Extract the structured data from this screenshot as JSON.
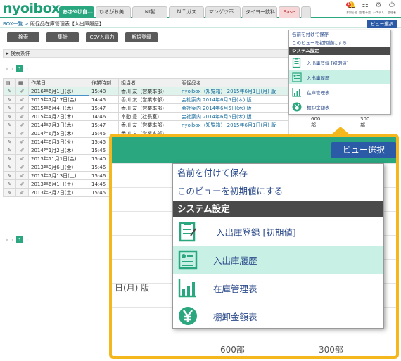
{
  "app": {
    "logo": "nyoibox"
  },
  "tabs": [
    {
      "label": "あさやけ自...",
      "active": true
    },
    {
      "label": "ひるがお美..."
    },
    {
      "label": "NI製"
    },
    {
      "label": "ＮＩガス"
    },
    {
      "label": "マンゲツ不..."
    },
    {
      "label": "タイヨー飲料"
    },
    {
      "label": "Base",
      "base": true
    },
    {
      "label": "⋮"
    }
  ],
  "top_icons": [
    {
      "icon": "notification-icon",
      "glyph": "🔔",
      "label": "お知らせ",
      "badge": "1"
    },
    {
      "icon": "org-chart-icon",
      "glyph": "⚏",
      "label": "部署不要"
    },
    {
      "icon": "gear-icon",
      "glyph": "⚙",
      "label": "システム"
    },
    {
      "icon": "power-icon",
      "glyph": "⏻",
      "label": "管理者"
    }
  ],
  "breadcrumb": {
    "root": "BOX一覧",
    "sep": " > ",
    "current": "販促品在庫管理表【入出庫履歴】"
  },
  "view_select_label": "ビュー選択",
  "action_buttons": [
    "検索",
    "集計",
    "CSV入出力",
    "新規登録"
  ],
  "search_conditions_label": "▸ 検索条件",
  "pager": {
    "first": "«",
    "prev": "‹",
    "page": "1",
    "next": "›"
  },
  "table": {
    "headers": [
      "作業日",
      "作業時刻",
      "担当者",
      "販促品名"
    ],
    "rows": [
      {
        "date": "2016年6月1日(水)",
        "time": "15:48",
        "person": "香川 友（営業本部）",
        "item": "nyoibox（知覧箱） 2015年6月1日(月) 版"
      },
      {
        "date": "2015年7月17日(金)",
        "time": "14:45",
        "person": "香川 友（営業本部）",
        "item": "会社案内 2014年6月5日(木) 版"
      },
      {
        "date": "2015年6月4日(木)",
        "time": "15:47",
        "person": "香川 友（営業本部）",
        "item": "会社案内 2014年6月5日(木) 版"
      },
      {
        "date": "2015年4月2日(木)",
        "time": "14:46",
        "person": "本動 豊（社長室）",
        "item": "会社案内 2014年6月5日(木) 版"
      },
      {
        "date": "2014年7月3日(木)",
        "time": "15:47",
        "person": "香川 友（営業本部）",
        "item": "nyoibox（知覧箱） 2015年6月1日(月) 版"
      },
      {
        "date": "2014年6月5日(木)",
        "time": "15:45",
        "person": "香川 友（営業本部）",
        "item": ""
      },
      {
        "date": "2014年6月3日(火)",
        "time": "15:45",
        "person": "香川 友（営業本部）",
        "item": ""
      },
      {
        "date": "2014年1月2日(木)",
        "time": "15:45",
        "person": "香川 友（営業本部）",
        "item": ""
      },
      {
        "date": "2013年11月1日(金)",
        "time": "15:40",
        "person": "香川 友（営業本部）",
        "item": ""
      },
      {
        "date": "2013年9月6日(金)",
        "time": "15:46",
        "person": "香川 友（営業本部）",
        "item": ""
      },
      {
        "date": "2013年7月13日(土)",
        "time": "15:46",
        "person": "香川 友（営業本部）",
        "item": ""
      },
      {
        "date": "2013年6月1日(土)",
        "time": "14:45",
        "person": "香川 友（営業本部）",
        "item": ""
      },
      {
        "date": "2013年3月2日(土)",
        "time": "15:45",
        "person": "香川 友（営業本部）",
        "item": ""
      }
    ]
  },
  "right_cells": {
    "qty": "600部",
    "qty2": "300部"
  },
  "view_menu": {
    "save_as": "名前を付けて保存",
    "set_default": "このビューを初期値にする",
    "system_header": "システム設定",
    "items": [
      {
        "label": "入出庫登録 [初期値]",
        "icon": "clipboard-icon"
      },
      {
        "label": "入出庫履歴",
        "icon": "history-list-icon",
        "highlight": true
      },
      {
        "label": "在庫管理表",
        "icon": "bar-chart-icon"
      },
      {
        "label": "棚卸金額表",
        "icon": "yen-coin-icon"
      }
    ]
  },
  "callout": {
    "bg_text_1": "日(月) 版",
    "bg_qty_1": "600部",
    "bg_qty_2": "300部"
  },
  "colors": {
    "brand": "#2aa77f",
    "view_button": "#2b5aa6",
    "callout_border": "#f4b71c",
    "menu_highlight": "#c9f0e5"
  }
}
